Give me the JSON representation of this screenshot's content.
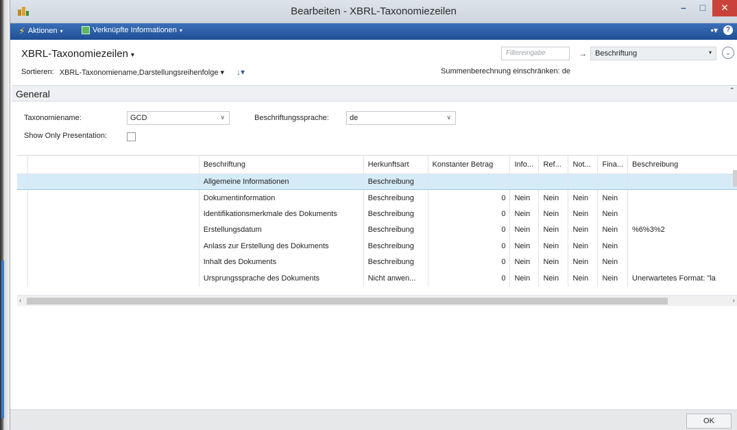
{
  "window": {
    "title": "Bearbeiten - XBRL-Taxonomiezeilen",
    "minimize_glyph": "–",
    "maximize_glyph": "□",
    "close_glyph": "✕"
  },
  "actionbar": {
    "actions_label": "Aktionen",
    "related_label": "Verknüpfte Informationen",
    "caret": "▾",
    "help_glyph": "?"
  },
  "page": {
    "title": "XBRL-Taxonomiezeilen",
    "sort_label": "Sortieren:",
    "sort_value": "XBRL-Taxonomiename,Darstellungsreihenfolge",
    "sum_restrict": "Summenberechnung einschränken: de",
    "filter_placeholder": "Filtereingabe",
    "filter_field": "Beschriftung"
  },
  "general": {
    "header": "General",
    "taxonomy_label": "Taxonomiename:",
    "taxonomy_value": "GCD",
    "language_label": "Beschriftungssprache:",
    "language_value": "de",
    "presentation_label": "Show Only Presentation:"
  },
  "grid": {
    "columns": [
      "Beschriftung",
      "Herkunftsart",
      "Konstanter Betrag",
      "Info...",
      "Ref...",
      "Not...",
      "Fina...",
      "Beschreibung"
    ],
    "rows": [
      [
        "Allgemeine Informationen",
        "Beschreibung",
        "",
        "",
        "",
        "",
        "",
        ""
      ],
      [
        "Dokumentinformation",
        "Beschreibung",
        "0",
        "Nein",
        "Nein",
        "Nein",
        "Nein",
        ""
      ],
      [
        "Identifikationsmerkmale des Dokuments",
        "Beschreibung",
        "0",
        "Nein",
        "Nein",
        "Nein",
        "Nein",
        ""
      ],
      [
        "Erstellungsdatum",
        "Beschreibung",
        "0",
        "Nein",
        "Nein",
        "Nein",
        "Nein",
        "%6%3%2"
      ],
      [
        "Anlass zur Erstellung des Dokuments",
        "Beschreibung",
        "0",
        "Nein",
        "Nein",
        "Nein",
        "Nein",
        ""
      ],
      [
        "Inhalt des Dokuments",
        "Beschreibung",
        "0",
        "Nein",
        "Nein",
        "Nein",
        "Nein",
        ""
      ],
      [
        "Ursprungssprache des Dokuments",
        "Nicht anwen...",
        "0",
        "Nein",
        "Nein",
        "Nein",
        "Nein",
        "Unerwartetes Format: \"la"
      ]
    ]
  },
  "footer": {
    "ok_label": "OK"
  }
}
